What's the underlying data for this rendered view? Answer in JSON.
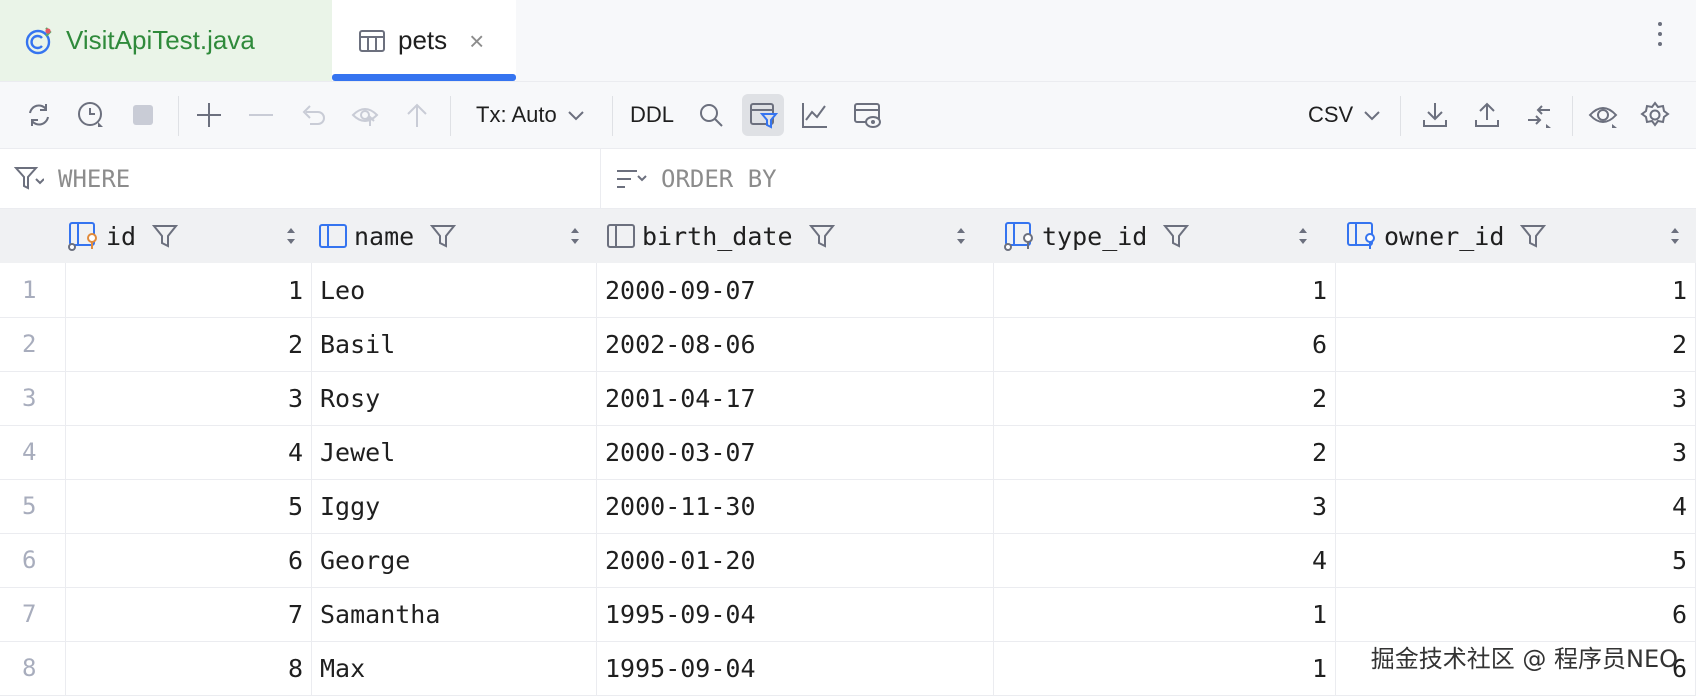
{
  "tabs": [
    {
      "label": "VisitApiTest.java",
      "icon": "java-test-class-icon",
      "active": false,
      "color": "#2f8a3b"
    },
    {
      "label": "pets",
      "icon": "table-icon",
      "active": true,
      "close": "×"
    }
  ],
  "toolbar": {
    "tx_mode": "Tx: Auto",
    "ddl": "DDL",
    "export_format": "CSV",
    "buttons": [
      "refresh-icon",
      "history-icon",
      "stop-icon",
      "add-row-icon",
      "delete-row-icon",
      "revert-icon",
      "submit-icon",
      "commit-icon",
      "tx-dropdown",
      "ddl-button",
      "search-icon",
      "filter-icon",
      "chart-icon",
      "view-editor-icon",
      "csv-dropdown",
      "download-icon",
      "upload-icon",
      "compare-icon",
      "eye-icon",
      "settings-icon"
    ]
  },
  "filters": {
    "where": "WHERE",
    "order_by": "ORDER BY"
  },
  "columns": [
    {
      "name": "id",
      "icon": "primary-key-column-icon"
    },
    {
      "name": "name",
      "icon": "column-icon"
    },
    {
      "name": "birth_date",
      "icon": "column-icon"
    },
    {
      "name": "type_id",
      "icon": "foreign-key-column-icon"
    },
    {
      "name": "owner_id",
      "icon": "foreign-key-column-icon"
    }
  ],
  "rows": [
    {
      "n": "1",
      "id": "1",
      "name": "Leo",
      "birth_date": "2000-09-07",
      "type_id": "1",
      "owner_id": "1"
    },
    {
      "n": "2",
      "id": "2",
      "name": "Basil",
      "birth_date": "2002-08-06",
      "type_id": "6",
      "owner_id": "2"
    },
    {
      "n": "3",
      "id": "3",
      "name": "Rosy",
      "birth_date": "2001-04-17",
      "type_id": "2",
      "owner_id": "3"
    },
    {
      "n": "4",
      "id": "4",
      "name": "Jewel",
      "birth_date": "2000-03-07",
      "type_id": "2",
      "owner_id": "3"
    },
    {
      "n": "5",
      "id": "5",
      "name": "Iggy",
      "birth_date": "2000-11-30",
      "type_id": "3",
      "owner_id": "4"
    },
    {
      "n": "6",
      "id": "6",
      "name": "George",
      "birth_date": "2000-01-20",
      "type_id": "4",
      "owner_id": "5"
    },
    {
      "n": "7",
      "id": "7",
      "name": "Samantha",
      "birth_date": "1995-09-04",
      "type_id": "1",
      "owner_id": "6"
    },
    {
      "n": "8",
      "id": "8",
      "name": "Max",
      "birth_date": "1995-09-04",
      "type_id": "1",
      "owner_id": "6"
    }
  ],
  "watermark": "掘金技术社区 @ 程序员NEO",
  "colors": {
    "accent": "#3574f0",
    "key": "#e08a3c"
  }
}
